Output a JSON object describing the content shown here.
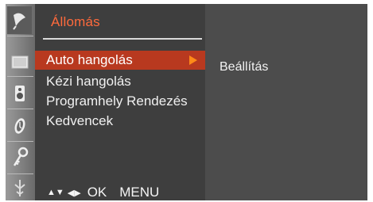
{
  "menu": {
    "title": "Állomás",
    "items": [
      {
        "label": "Auto hangolás",
        "active": true
      },
      {
        "label": "Kézi hangolás",
        "active": false
      },
      {
        "label": "Programhely Rendezés",
        "active": false
      },
      {
        "label": "Kedvencek",
        "active": false
      }
    ]
  },
  "submenu": {
    "label": "Beállítás"
  },
  "footer": {
    "updown_arrows": "▲▼",
    "leftright_arrows": "◀▶",
    "ok_label": "OK",
    "menu_label": "MENU"
  },
  "sidebar_icons": [
    "satellite-dish-icon",
    "screen-icon",
    "speaker-icon",
    "clock-icon",
    "key-icon",
    "antenna-icon"
  ],
  "colors": {
    "title": "#ff6a3c",
    "active_row": "#b8391f",
    "arrow": "#ff8a18",
    "panel": "#3e3e3e",
    "screen": "#4a4a4a"
  }
}
